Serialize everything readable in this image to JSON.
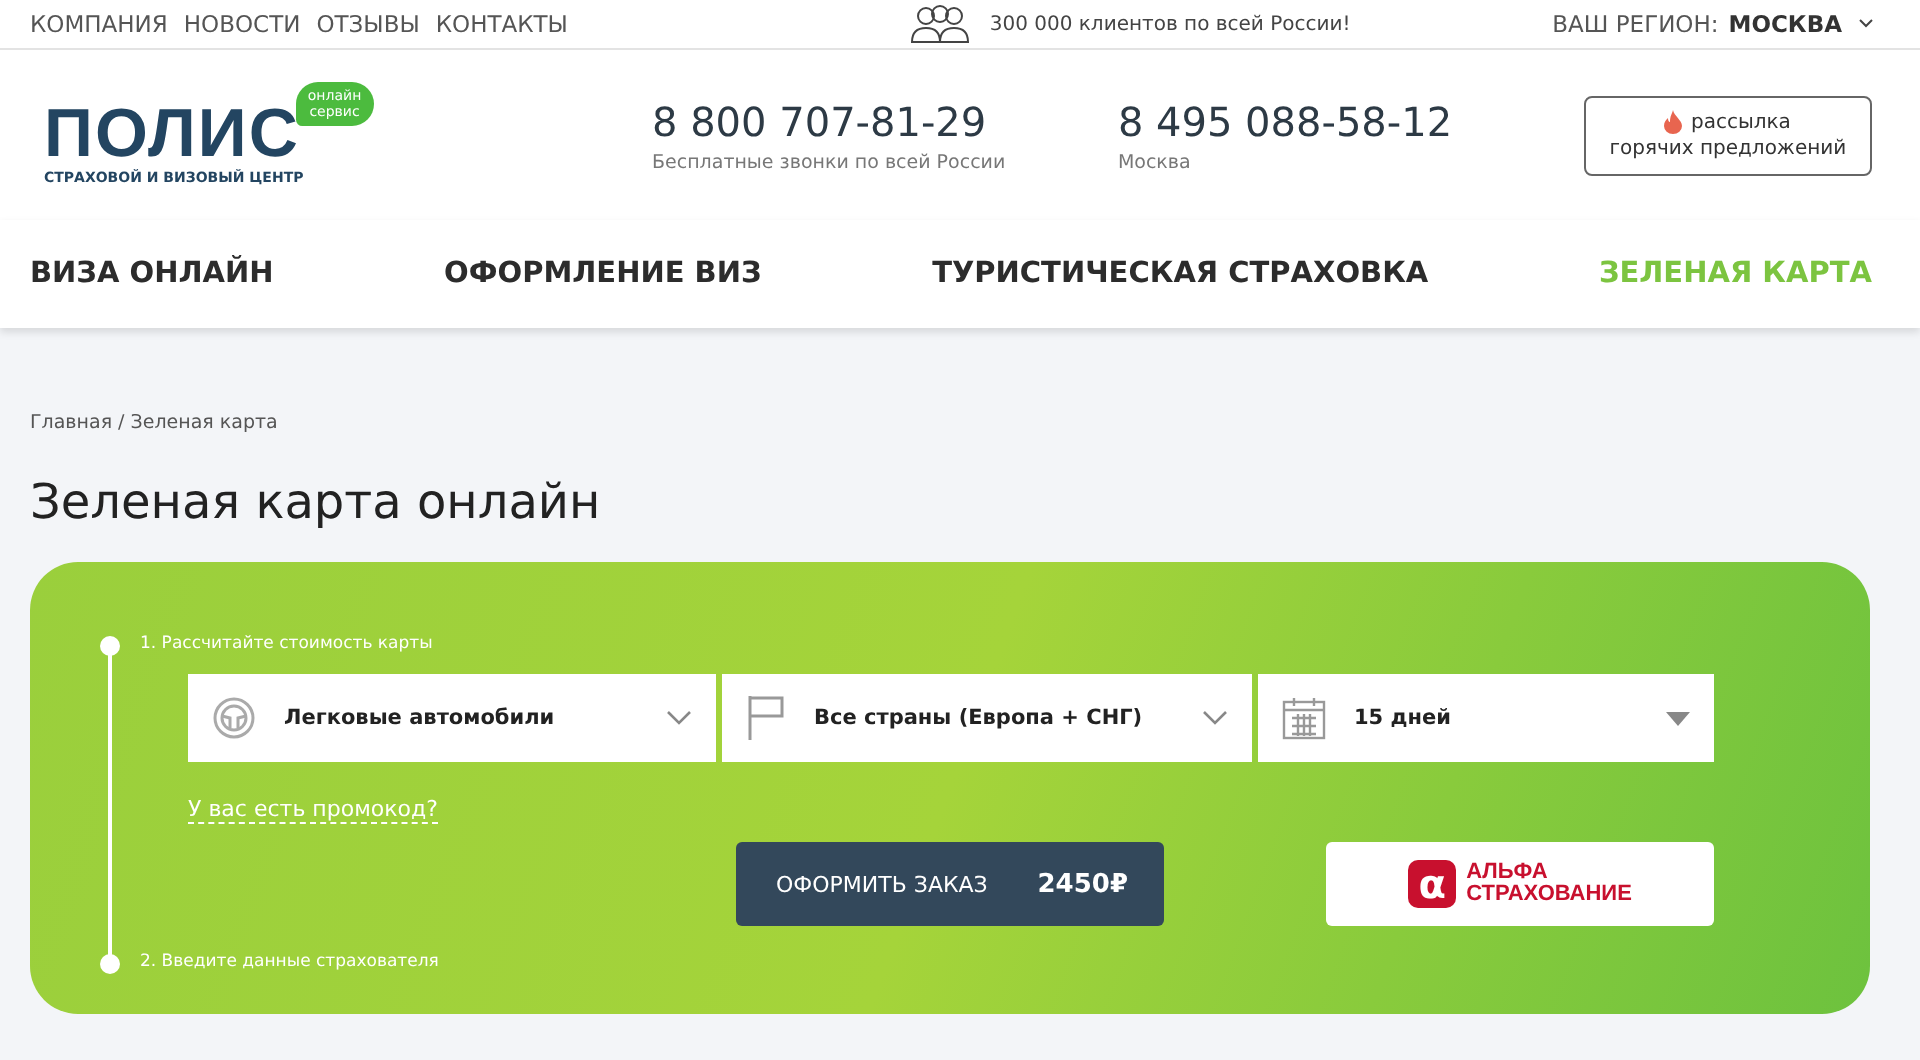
{
  "top_links": [
    "КОМПАНИЯ",
    "НОВОСТИ",
    "ОТЗЫВЫ",
    "КОНТАКТЫ"
  ],
  "clients_note": "300 000 клиентов по всей России!",
  "region": {
    "label": "ВАШ РЕГИОН:",
    "value": "МОСКВА"
  },
  "logo": {
    "name": "ПОЛИС",
    "badge_line1": "онлайн",
    "badge_line2": "сервис",
    "tagline": "СТРАХОВОЙ И ВИЗОВЫЙ ЦЕНТР"
  },
  "phones": [
    {
      "number": "8 800 707-81-29",
      "caption": "Бесплатные звонки по всей России"
    },
    {
      "number": "8 495 088-58-12",
      "caption": "Москва"
    }
  ],
  "subscribe_button": {
    "line1": "рассылка",
    "line2": "горячих предложений"
  },
  "nav": [
    {
      "label": "ВИЗА ОНЛАЙН",
      "selected": false
    },
    {
      "label": "ОФОРМЛЕНИЕ ВИЗ",
      "selected": false
    },
    {
      "label": "ТУРИСТИЧЕСКАЯ СТРАХОВКА",
      "selected": false
    },
    {
      "label": "ЗЕЛЕНАЯ КАРТА",
      "selected": true
    }
  ],
  "breadcrumb": "Главная / Зеленая карта",
  "title": "Зеленая карта онлайн",
  "steps": [
    "1. Рассчитайте стоимость карты",
    "2. Введите данные страхователя"
  ],
  "selects": [
    {
      "kind": "vehicle",
      "value": "Легковые автомобили"
    },
    {
      "kind": "region",
      "value": "Все страны (Европа + СНГ)"
    },
    {
      "kind": "period",
      "value": "15 дней"
    }
  ],
  "promo_link": "У вас есть промокод?",
  "order_button": {
    "label": "ОФОРМИТЬ ЗАКАЗ",
    "price": "2450₽"
  },
  "insurer": {
    "mark": "α",
    "line1": "АЛЬФА",
    "line2": "СТРАХОВАНИЕ"
  }
}
